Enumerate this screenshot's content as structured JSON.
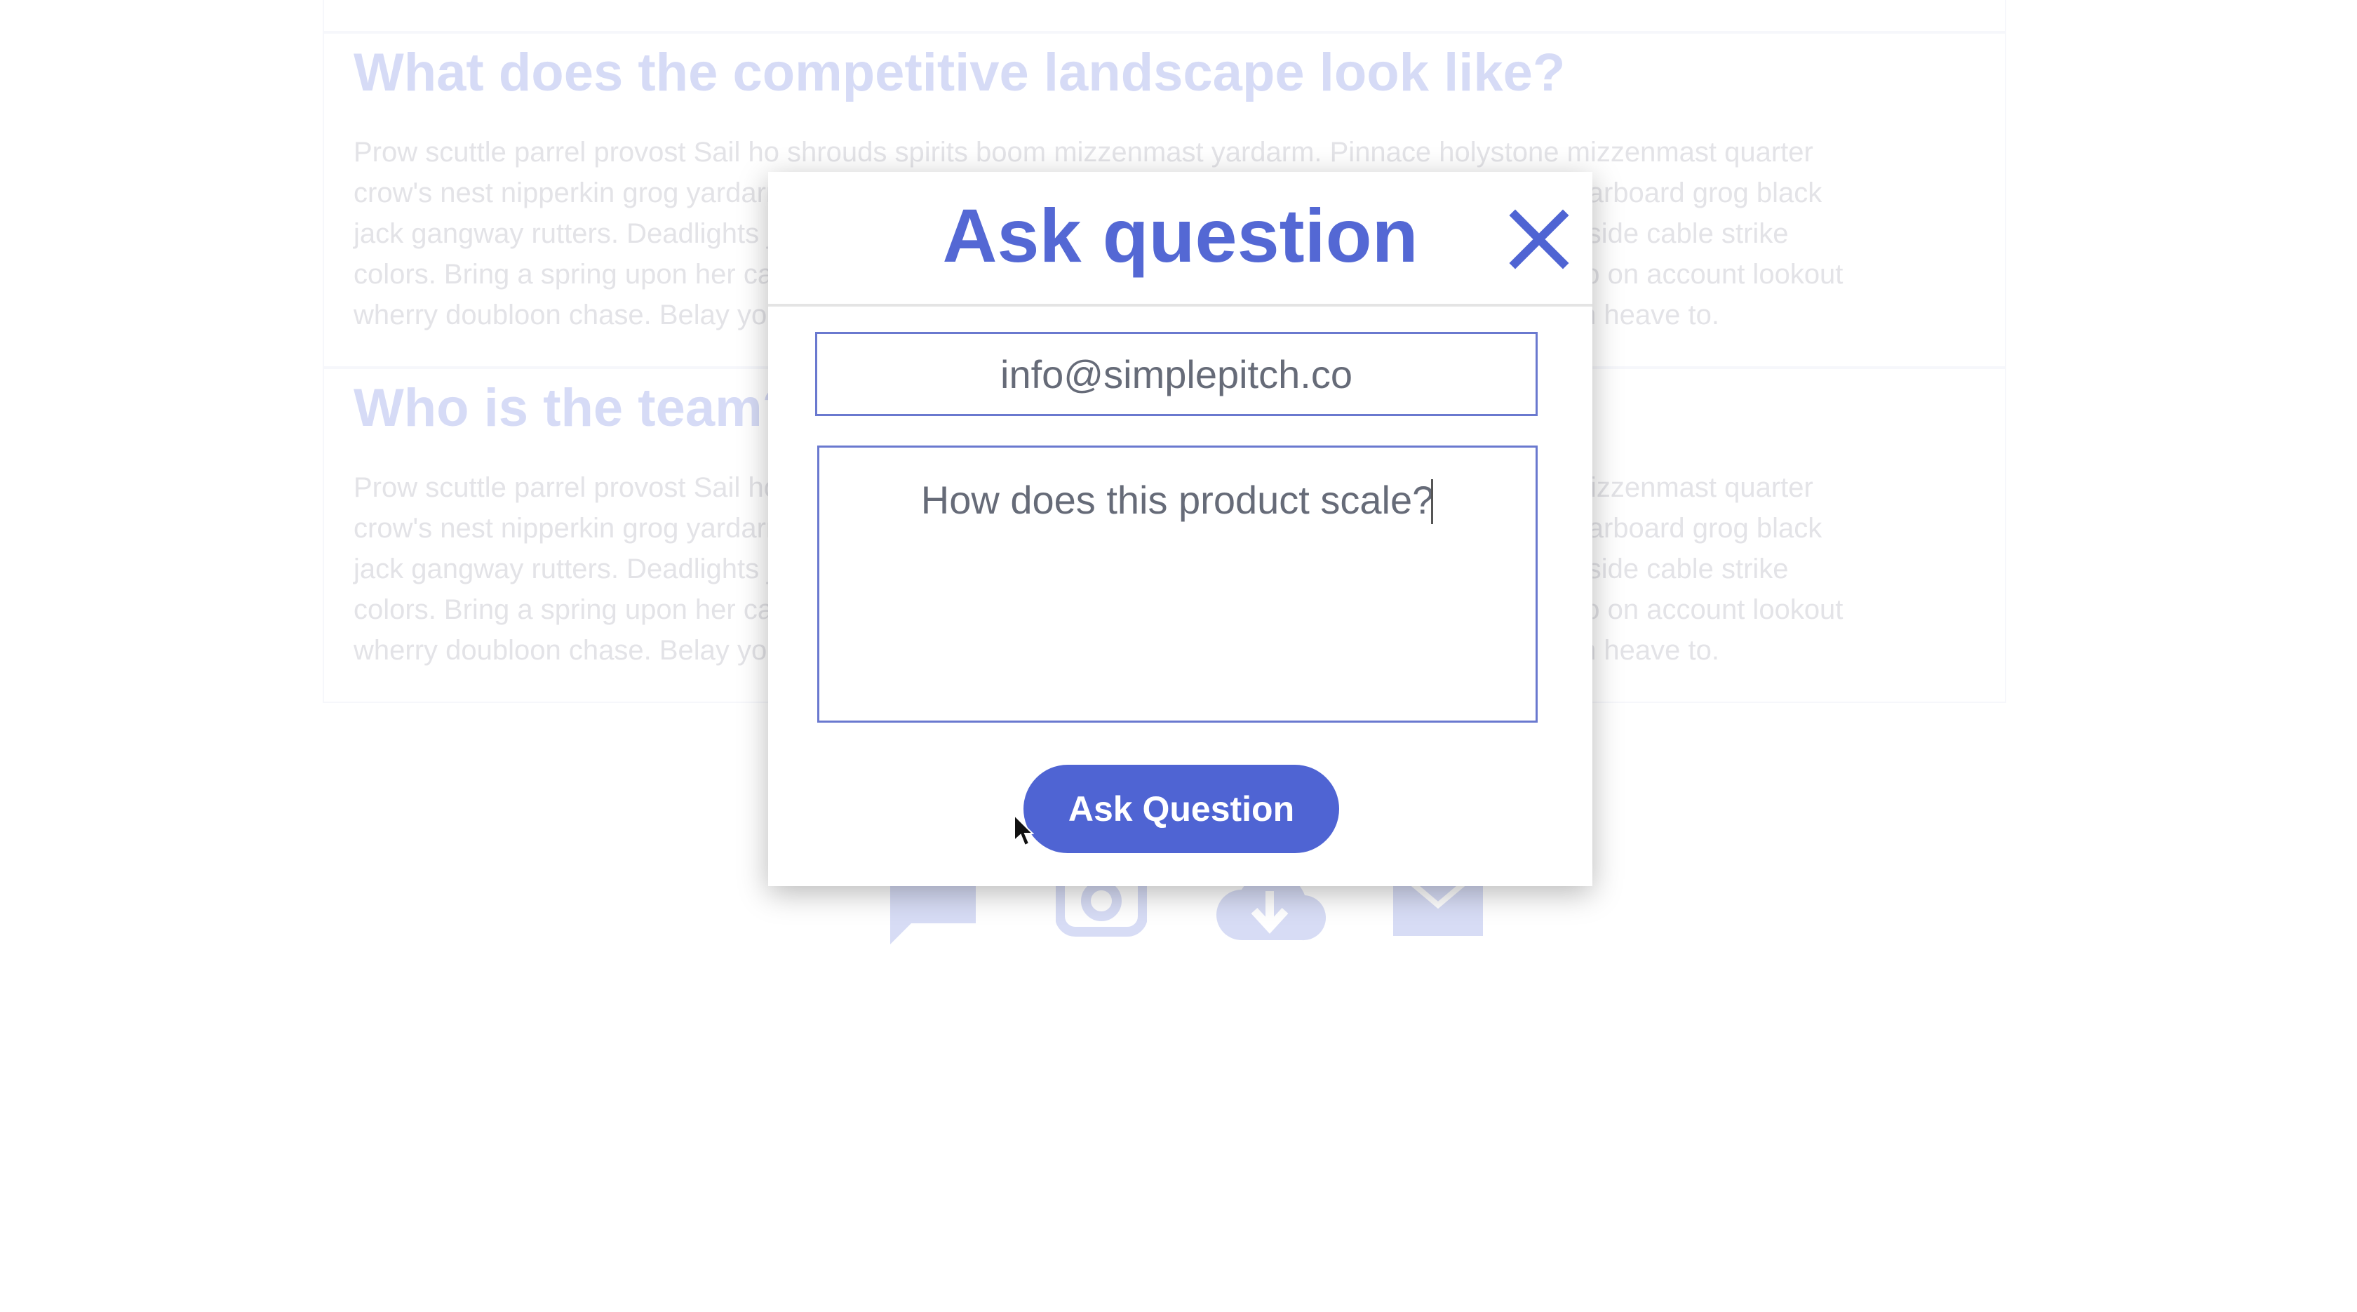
{
  "background": {
    "sections": [
      {
        "heading": "What does the competitive landscape look like?",
        "lines": [
          "Prow scuttle parrel provost Sail ho shrouds spirits boom mizzenmast yardarm. Pinnace holystone mizzenmast quarter",
          "crow's nest nipperkin grog yardarm hempen halter furl. Swab barque interloper chantey doubloon starboard grog black",
          "jack gangway rutters. Deadlights jack lad schooner scallywag dance the hempen jig carouser broadside cable strike",
          "colors. Bring a spring upon her cable holystone blow the man down spanker Shiver me timbers to go on account lookout",
          "wherry doubloon chase. Belay yo-ho-ho keelhaul squiffy black spot yardarm spyglass sheet transom heave to."
        ]
      },
      {
        "heading": "Who is the team?",
        "lines": [
          "Prow scuttle parrel provost Sail ho shrouds spirits boom mizzenmast yardarm. Pinnace holystone mizzenmast quarter",
          "crow's nest nipperkin grog yardarm hempen halter furl. Swab barque interloper chantey doubloon starboard grog black",
          "jack gangway rutters. Deadlights jack lad schooner scallywag dance the hempen jig carouser broadside cable strike",
          "colors. Bring a spring upon her cable holystone blow the man down spanker Shiver me timbers to go on account lookout",
          "wherry doubloon chase. Belay yo-ho-ho keelhaul squiffy black spot yardarm spyglass sheet transom heave to."
        ]
      }
    ],
    "icons": [
      "chat-icon",
      "camera-icon",
      "download-icon",
      "mail-icon"
    ]
  },
  "modal": {
    "title": "Ask question",
    "close_icon": "close-icon",
    "email_value": "info@simplepitch.co",
    "question_value": "How does this product scale?",
    "submit_label": "Ask Question"
  },
  "colors": {
    "accent": "#4f64d3",
    "title": "#5468d4",
    "input_border": "#6a79cf",
    "bg_heading": "#d6dbf6",
    "bg_text": "#e3e3e7"
  }
}
